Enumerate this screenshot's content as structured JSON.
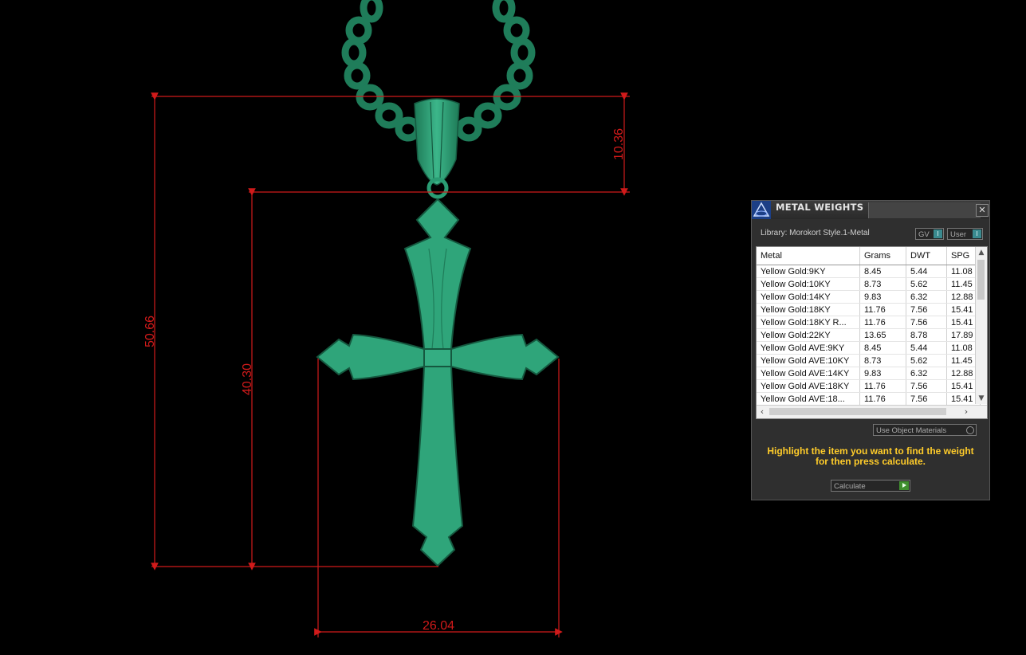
{
  "dimensions": {
    "height_total": "50.66",
    "height_cross": "40.30",
    "height_bail": "10.36",
    "width_cross": "26.04"
  },
  "colors": {
    "dimension_line": "#d01a1a",
    "model": "#2a9c73",
    "panel_bg": "#2f2f2f",
    "hint_text": "#ffcc2a"
  },
  "panel": {
    "title": "METAL WEIGHTS",
    "close_icon": "✕",
    "library_label": "Library: Morokort Style.1-Metal",
    "chip_gv": "GV",
    "chip_user": "User",
    "chip_toggle_icon": "I",
    "columns": [
      "Metal",
      "Grams",
      "DWT",
      "SPG"
    ],
    "rows": [
      [
        "Yellow Gold:9KY",
        "8.45",
        "5.44",
        "11.08"
      ],
      [
        "Yellow Gold:10KY",
        "8.73",
        "5.62",
        "11.45"
      ],
      [
        "Yellow Gold:14KY",
        "9.83",
        "6.32",
        "12.88"
      ],
      [
        "Yellow Gold:18KY",
        "11.76",
        "7.56",
        "15.41"
      ],
      [
        "Yellow Gold:18KY R...",
        "11.76",
        "7.56",
        "15.41"
      ],
      [
        "Yellow Gold:22KY",
        "13.65",
        "8.78",
        "17.89"
      ],
      [
        "Yellow Gold AVE:9KY",
        "8.45",
        "5.44",
        "11.08"
      ],
      [
        "Yellow Gold AVE:10KY",
        "8.73",
        "5.62",
        "11.45"
      ],
      [
        "Yellow Gold AVE:14KY",
        "9.83",
        "6.32",
        "12.88"
      ],
      [
        "Yellow Gold AVE:18KY",
        "11.76",
        "7.56",
        "15.41"
      ],
      [
        "Yellow Gold AVE:18...",
        "11.76",
        "7.56",
        "15.41"
      ]
    ],
    "use_object_materials": "Use Object Materials",
    "hint": "Highlight the item you want to find the weight for then press calculate.",
    "calculate_label": "Calculate"
  }
}
